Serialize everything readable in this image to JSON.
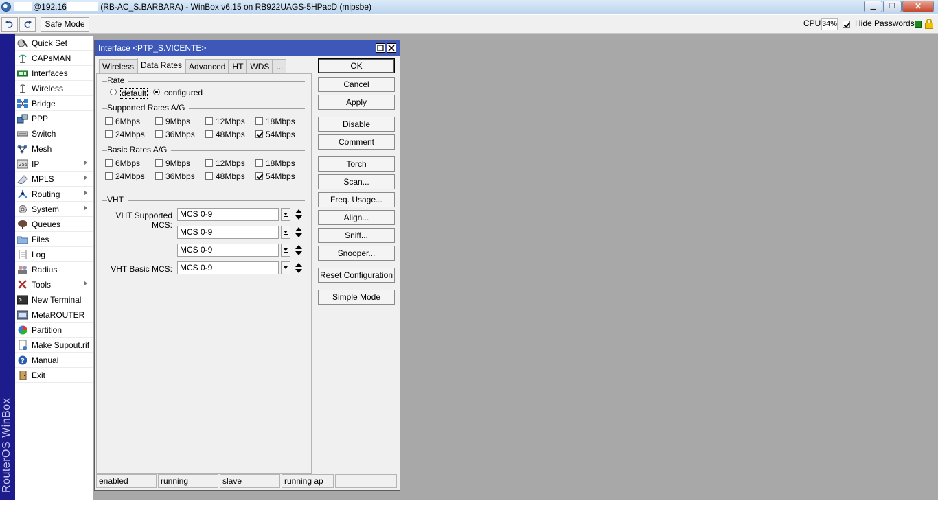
{
  "window": {
    "title_user_redacted": "",
    "title_host_prefix": "@192.16",
    "title_rest": "(RB-AC_S.BARBARA) - WinBox v6.15 on RB922UAGS-5HPacD (mipsbe)",
    "minimize": "▁",
    "maximize": "❐",
    "close": "✕"
  },
  "toolbar": {
    "safe_mode": "Safe Mode",
    "cpu_label": "CPU:",
    "cpu_value": "34%",
    "hide_passwords": "Hide Passwords",
    "hide_passwords_checked": true
  },
  "brand": "RouterOS WinBox",
  "sidebar": {
    "items": [
      {
        "label": "Quick Set",
        "icon": "quick-set-icon"
      },
      {
        "label": "CAPsMAN",
        "icon": "capsman-icon"
      },
      {
        "label": "Interfaces",
        "icon": "interfaces-icon"
      },
      {
        "label": "Wireless",
        "icon": "wireless-icon"
      },
      {
        "label": "Bridge",
        "icon": "bridge-icon"
      },
      {
        "label": "PPP",
        "icon": "ppp-icon"
      },
      {
        "label": "Switch",
        "icon": "switch-icon"
      },
      {
        "label": "Mesh",
        "icon": "mesh-icon"
      },
      {
        "label": "IP",
        "icon": "ip-icon",
        "submenu": true
      },
      {
        "label": "MPLS",
        "icon": "mpls-icon",
        "submenu": true
      },
      {
        "label": "Routing",
        "icon": "routing-icon",
        "submenu": true
      },
      {
        "label": "System",
        "icon": "system-icon",
        "submenu": true
      },
      {
        "label": "Queues",
        "icon": "queues-icon"
      },
      {
        "label": "Files",
        "icon": "files-icon"
      },
      {
        "label": "Log",
        "icon": "log-icon"
      },
      {
        "label": "Radius",
        "icon": "radius-icon"
      },
      {
        "label": "Tools",
        "icon": "tools-icon",
        "submenu": true
      },
      {
        "label": "New Terminal",
        "icon": "terminal-icon"
      },
      {
        "label": "MetaROUTER",
        "icon": "metarouter-icon"
      },
      {
        "label": "Partition",
        "icon": "partition-icon"
      },
      {
        "label": "Make Supout.rif",
        "icon": "supout-icon"
      },
      {
        "label": "Manual",
        "icon": "manual-icon"
      },
      {
        "label": "Exit",
        "icon": "exit-icon"
      }
    ]
  },
  "dialog": {
    "title": "Interface <PTP_S.VICENTE>",
    "tabs": [
      "Wireless",
      "Data Rates",
      "Advanced",
      "HT",
      "WDS",
      "..."
    ],
    "active_tab": "Data Rates",
    "rate": {
      "title": "Rate",
      "options": [
        "default",
        "configured"
      ],
      "selected": "configured"
    },
    "supported_rates": {
      "title": "Supported Rates A/G",
      "items": [
        {
          "label": "6Mbps",
          "checked": false
        },
        {
          "label": "9Mbps",
          "checked": false
        },
        {
          "label": "12Mbps",
          "checked": false
        },
        {
          "label": "18Mbps",
          "checked": false
        },
        {
          "label": "24Mbps",
          "checked": false
        },
        {
          "label": "36Mbps",
          "checked": false
        },
        {
          "label": "48Mbps",
          "checked": false
        },
        {
          "label": "54Mbps",
          "checked": true
        }
      ]
    },
    "basic_rates": {
      "title": "Basic Rates A/G",
      "items": [
        {
          "label": "6Mbps",
          "checked": false
        },
        {
          "label": "9Mbps",
          "checked": false
        },
        {
          "label": "12Mbps",
          "checked": false
        },
        {
          "label": "18Mbps",
          "checked": false
        },
        {
          "label": "24Mbps",
          "checked": false
        },
        {
          "label": "36Mbps",
          "checked": false
        },
        {
          "label": "48Mbps",
          "checked": false
        },
        {
          "label": "54Mbps",
          "checked": true
        }
      ]
    },
    "vht": {
      "title": "VHT",
      "supported_label": "VHT Supported MCS:",
      "supported_values": [
        "MCS 0-9",
        "MCS 0-9",
        "MCS 0-9"
      ],
      "basic_label": "VHT Basic MCS:",
      "basic_value": "MCS 0-9"
    },
    "buttons": [
      "OK",
      "Cancel",
      "Apply",
      "Disable",
      "Comment",
      "Torch",
      "Scan...",
      "Freq. Usage...",
      "Align...",
      "Sniff...",
      "Snooper...",
      "Reset Configuration",
      "Simple Mode"
    ],
    "status": [
      "enabled",
      "running",
      "slave",
      "running ap",
      ""
    ]
  },
  "colors": {
    "dialog_title_bg": "#3d58b8",
    "brand_strip": "#1d1c8c",
    "workspace_bg": "#a8a8a8"
  }
}
